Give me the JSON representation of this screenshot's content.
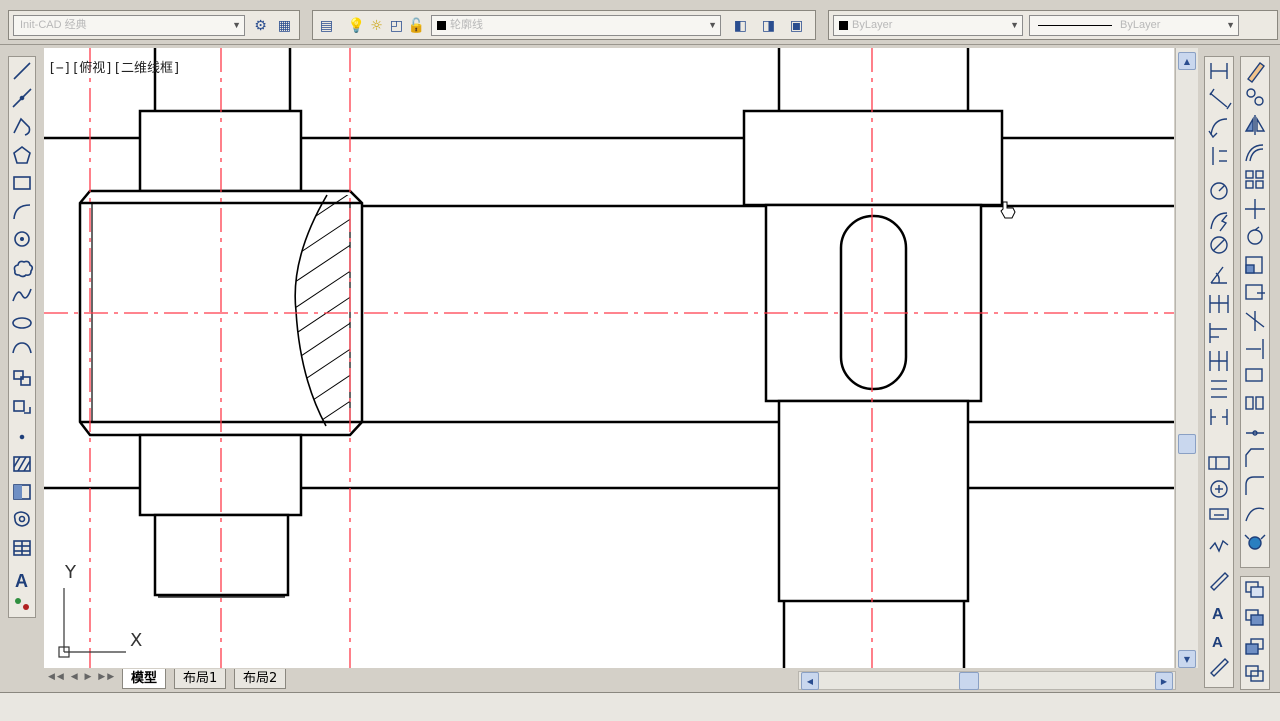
{
  "toolbar": {
    "workspace": "Init-CAD 经典",
    "layer": "轮廓线",
    "color": "ByLayer",
    "linetype": "ByLayer"
  },
  "viewport": {
    "label": "[−][俯视][二维线框]",
    "ucs_x": "X",
    "ucs_y": "Y"
  },
  "tabs": [
    "模型",
    "布局1",
    "布局2"
  ],
  "icons": {
    "left": [
      "line-icon",
      "construction-line-icon",
      "polyline-icon",
      "polygon-icon",
      "rectangle-icon",
      "arc-icon",
      "circle-icon",
      "revision-cloud-icon",
      "spline-icon",
      "ellipse-icon",
      "ellipse-arc-icon",
      "insert-block-icon",
      "make-block-icon",
      "point-icon",
      "hatch-icon",
      "gradient-icon",
      "region-icon",
      "table-icon",
      "mtext-icon",
      "add-selected-icon"
    ],
    "right1": [
      "linear-dimension-icon",
      "aligned-dimension-icon",
      "arc-length-icon",
      "ordinate-icon",
      "radius-icon",
      "jogged-icon",
      "diameter-icon",
      "angular-icon",
      "quick-dimension-icon",
      "baseline-icon",
      "continue-icon",
      "space-icon",
      "break-icon",
      "tolerance-icon",
      "center-mark-icon",
      "inspection-icon",
      "jogged-linear-icon",
      "dim-edit-icon",
      "dim-text-edit-icon",
      "dim-update-icon",
      "dim-style-icon"
    ],
    "right2": [
      "erase-icon",
      "copy-icon",
      "mirror-icon",
      "offset-icon",
      "array-icon",
      "move-icon",
      "rotate-icon",
      "scale-icon",
      "stretch-icon",
      "trim-icon",
      "extend-icon",
      "break-at-point-icon",
      "break-icon",
      "join-icon",
      "chamfer-icon",
      "fillet-icon",
      "blend-icon",
      "explode-icon"
    ],
    "right3": [
      "draw-order-icon",
      "bring-front-icon",
      "send-back-icon",
      "above-object-icon"
    ]
  }
}
